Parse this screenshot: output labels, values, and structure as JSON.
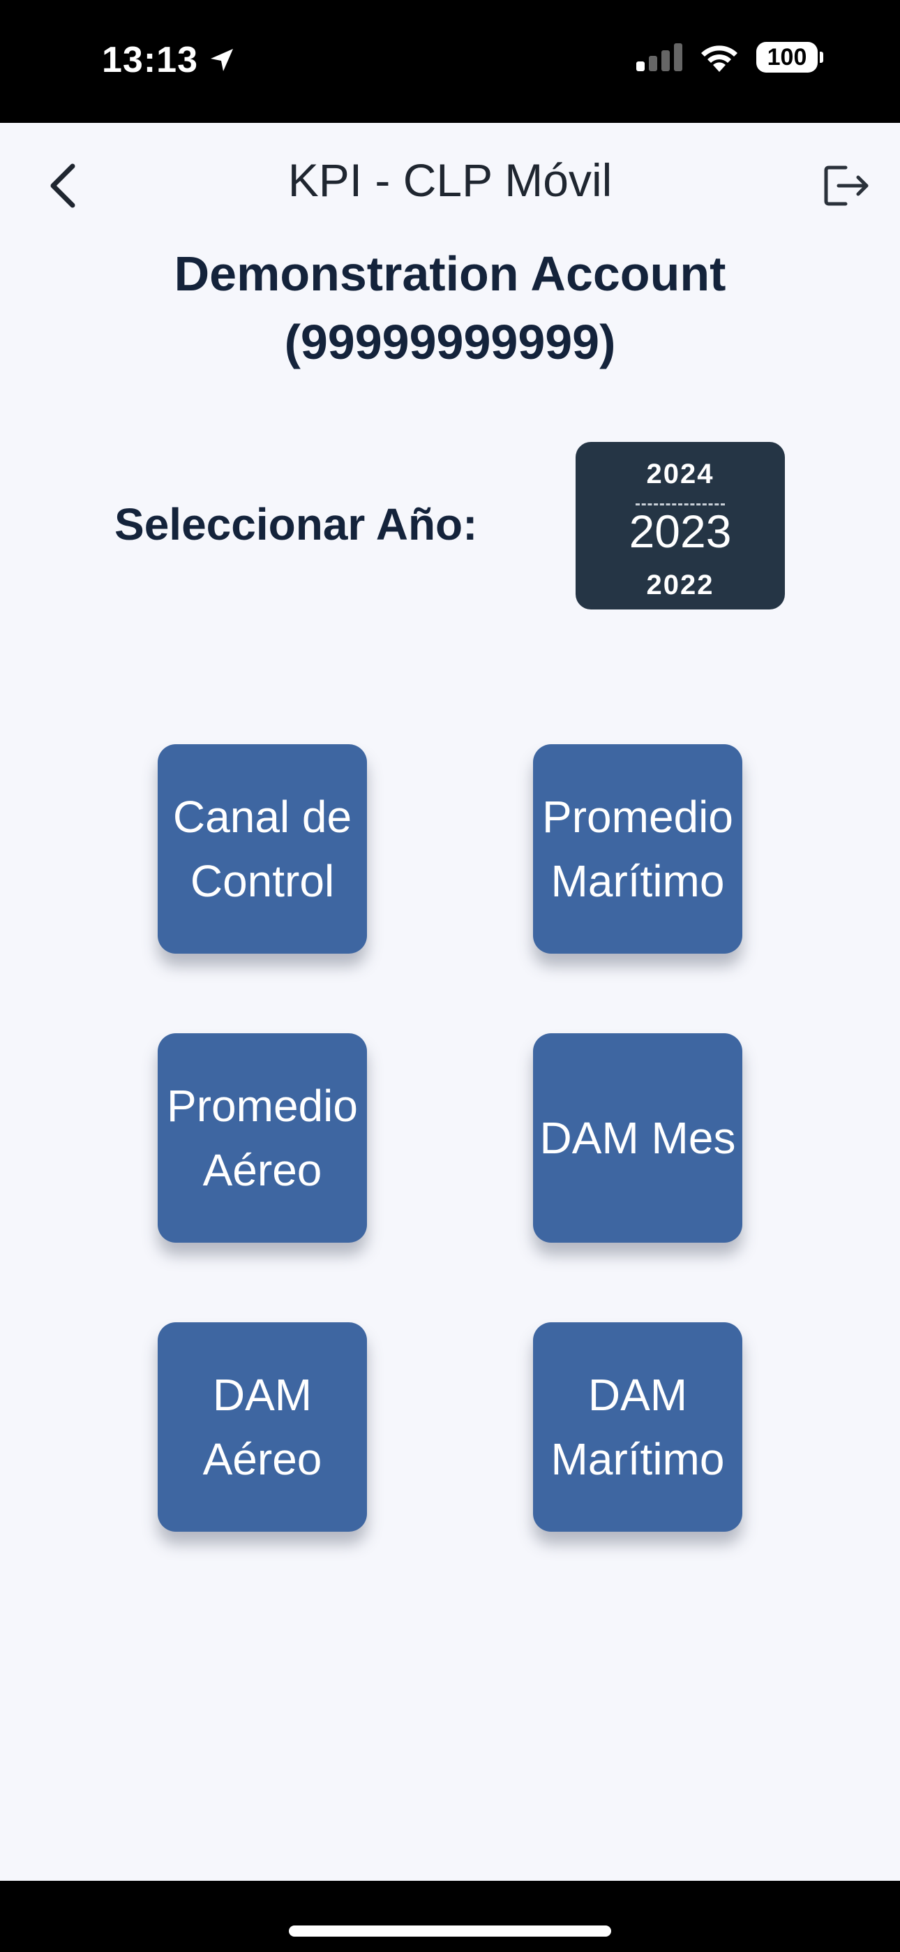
{
  "status_bar": {
    "time": "13:13",
    "battery": "100",
    "icons": [
      "location-arrow-icon",
      "cellular-signal-icon",
      "wifi-icon",
      "battery-icon"
    ]
  },
  "nav": {
    "title": "KPI - CLP Móvil",
    "back_icon": "chevron-left-icon",
    "logout_icon": "logout-icon"
  },
  "account": {
    "name": "Demonstration Account",
    "number": "(99999999999)"
  },
  "year_selector": {
    "label": "Seleccionar Año:",
    "options": [
      "2024",
      "2023",
      "2022"
    ],
    "selected": "2023"
  },
  "kpi_buttons": [
    {
      "label": "Canal de\nControl"
    },
    {
      "label": "Promedio\nMarítimo"
    },
    {
      "label": "Promedio\nAéreo"
    },
    {
      "label": "DAM Mes"
    },
    {
      "label": "DAM\nAéreo"
    },
    {
      "label": "DAM\nMarítimo"
    }
  ],
  "colors": {
    "status_bar_bg": "#000000",
    "page_bg": "#f6f7fc",
    "kpi_button_bg": "#3e66a1",
    "picker_bg": "#253545",
    "heading_text": "#14233b"
  }
}
